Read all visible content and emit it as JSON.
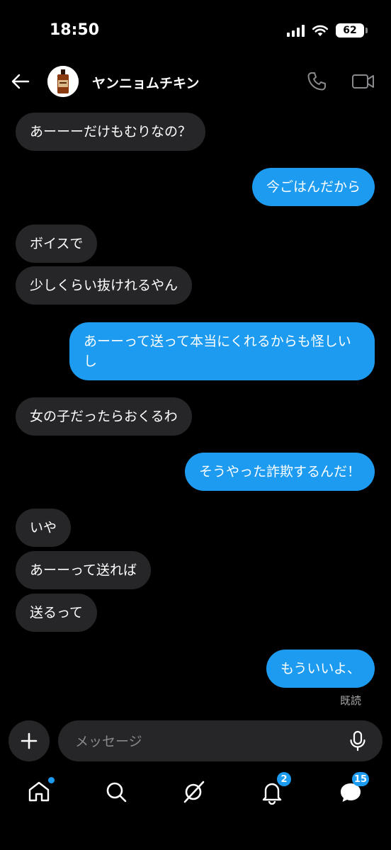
{
  "status_bar": {
    "time": "18:50",
    "battery": "62"
  },
  "header": {
    "contact_name": "ヤンニョムチキン"
  },
  "messages": [
    {
      "side": "in",
      "text": "あーーーだけもむりなの？"
    },
    {
      "side": "out",
      "text": "今ごはんだから"
    },
    {
      "side": "in",
      "text": "ボイスで"
    },
    {
      "side": "in",
      "text": "少しくらい抜けれるやん"
    },
    {
      "side": "out",
      "text": "あーーって送って本当にくれるからも怪しいし"
    },
    {
      "side": "in",
      "text": "女の子だったらおくるわ"
    },
    {
      "side": "out",
      "text": "そうやった詐欺するんだ！"
    },
    {
      "side": "in",
      "text": "いや"
    },
    {
      "side": "in",
      "text": "あーーって送れば"
    },
    {
      "side": "in",
      "text": "送るって"
    },
    {
      "side": "out",
      "text": "もういいよ、"
    }
  ],
  "read_receipt": "既読",
  "composer": {
    "placeholder": "メッセージ"
  },
  "tabbar": {
    "items": [
      {
        "icon": "home-icon",
        "has_dot": true
      },
      {
        "icon": "search-icon"
      },
      {
        "icon": "grok-icon"
      },
      {
        "icon": "bell-icon",
        "badge": "2"
      },
      {
        "icon": "messages-icon",
        "badge": "15"
      }
    ]
  },
  "colors": {
    "accent": "#1d9bf0",
    "incoming_bubble": "#262628",
    "background": "#000000"
  }
}
